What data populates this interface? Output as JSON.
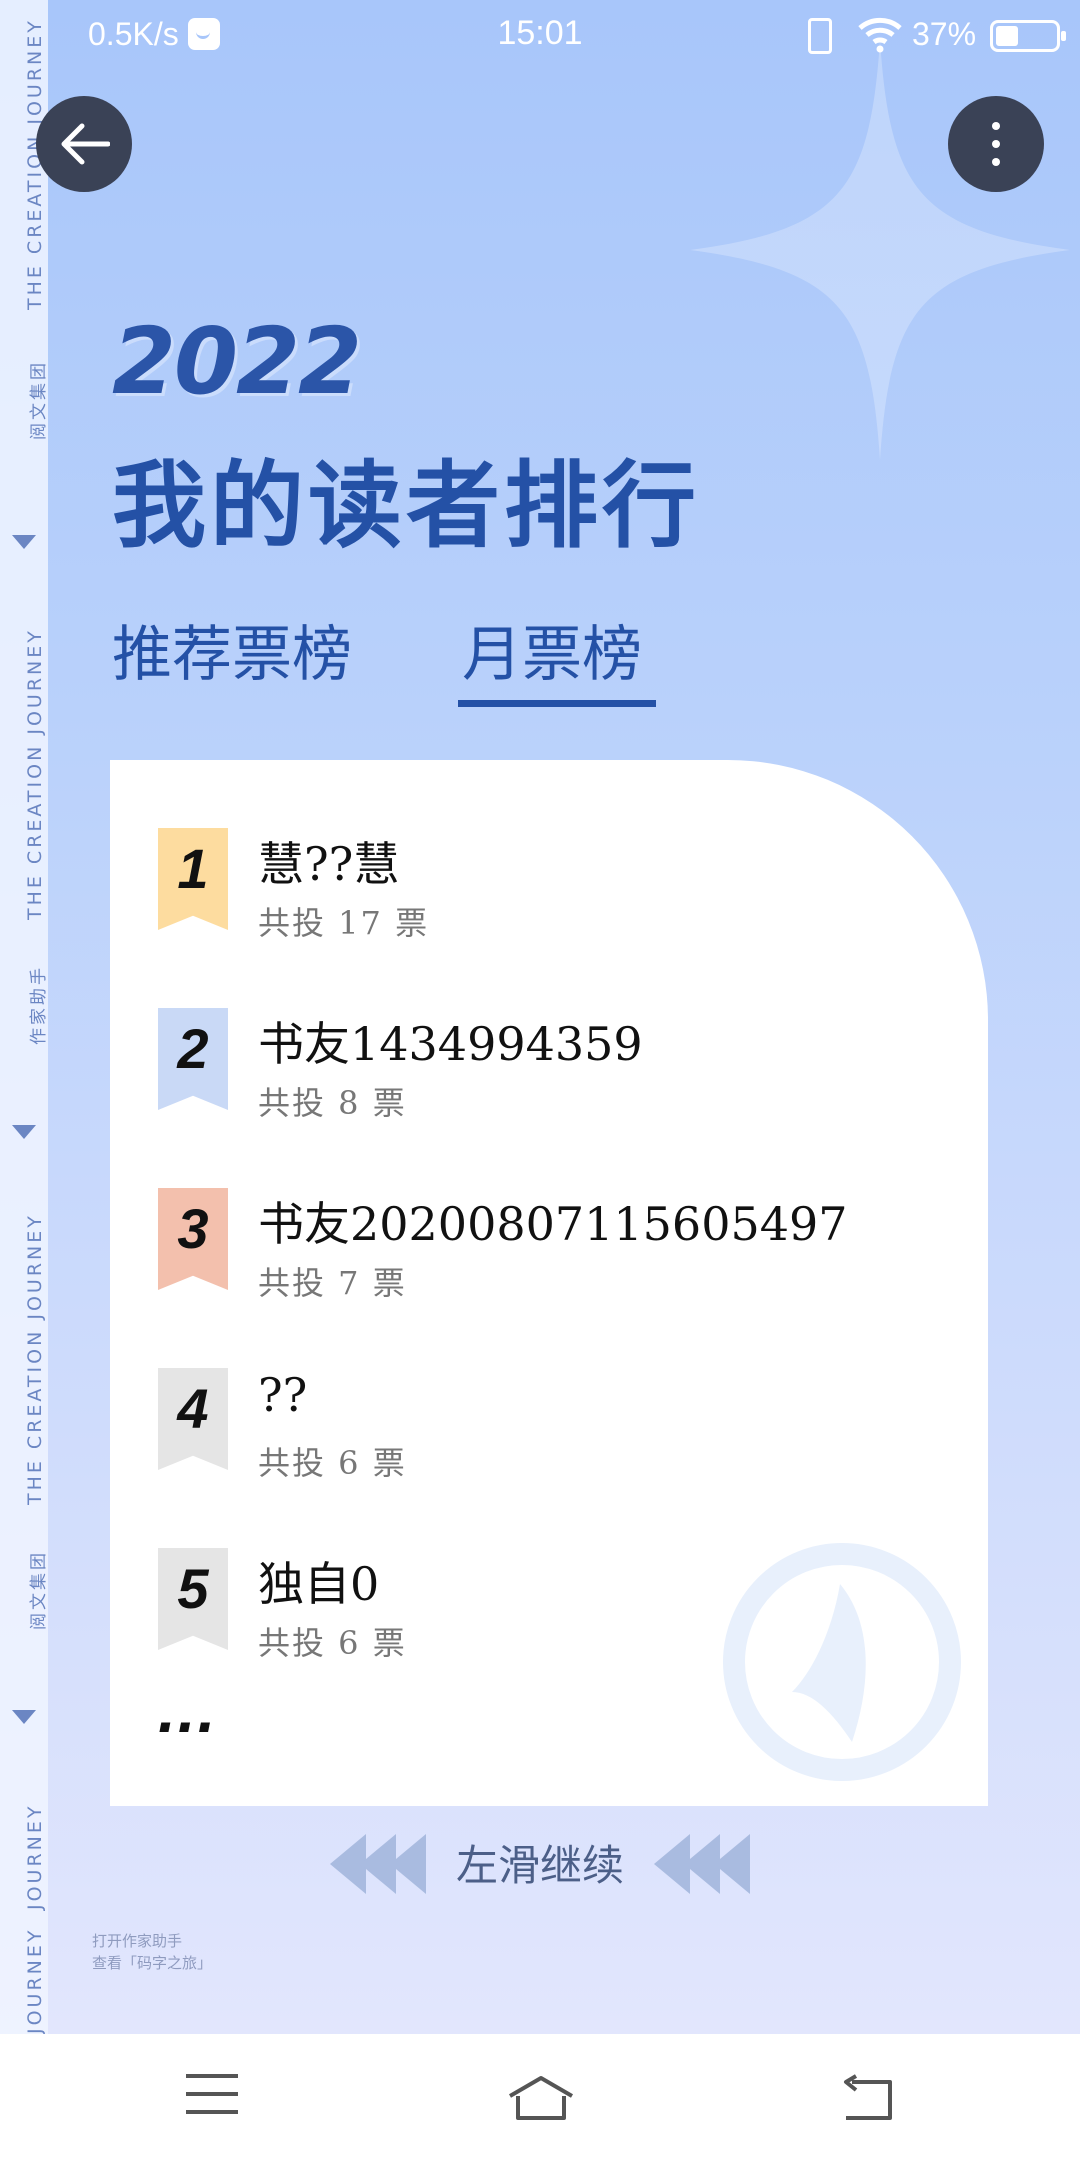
{
  "status_bar": {
    "network_speed": "0.5K/s",
    "time": "15:01",
    "battery": "37%",
    "icons": [
      "message-icon",
      "vibrate-icon",
      "wifi-icon",
      "battery-icon"
    ]
  },
  "side_strip": {
    "journey": "THE CREATION JOURNEY",
    "brand1": "阅文集团",
    "brand2": "作家助手",
    "partial": "JOURNEY"
  },
  "header": {
    "year": "2022",
    "title": "我的读者排行"
  },
  "tabs": [
    {
      "label": "推荐票榜",
      "active": false
    },
    {
      "label": "月票榜",
      "active": true
    }
  ],
  "ranking": [
    {
      "rank": "1",
      "name": "慧??慧",
      "votes": "共投 17 票"
    },
    {
      "rank": "2",
      "name": "书友1434994359",
      "votes": "共投 8 票"
    },
    {
      "rank": "3",
      "name": "书友20200807115605497",
      "votes": "共投 7 票"
    },
    {
      "rank": "4",
      "name": "??",
      "votes": "共投 6 票"
    },
    {
      "rank": "5",
      "name": "独自0",
      "votes": "共投 6 票"
    }
  ],
  "more": "...",
  "swipe_hint": "左滑继续",
  "footer_note": {
    "line1": "打开作家助手",
    "line2": "查看「码字之旅」"
  },
  "colors": {
    "accent": "#2451a6",
    "rank1": "#fddc9f",
    "rank2": "#c9d9f6",
    "rank3": "#f3c0ad",
    "rank_other": "#e5e5e5"
  }
}
